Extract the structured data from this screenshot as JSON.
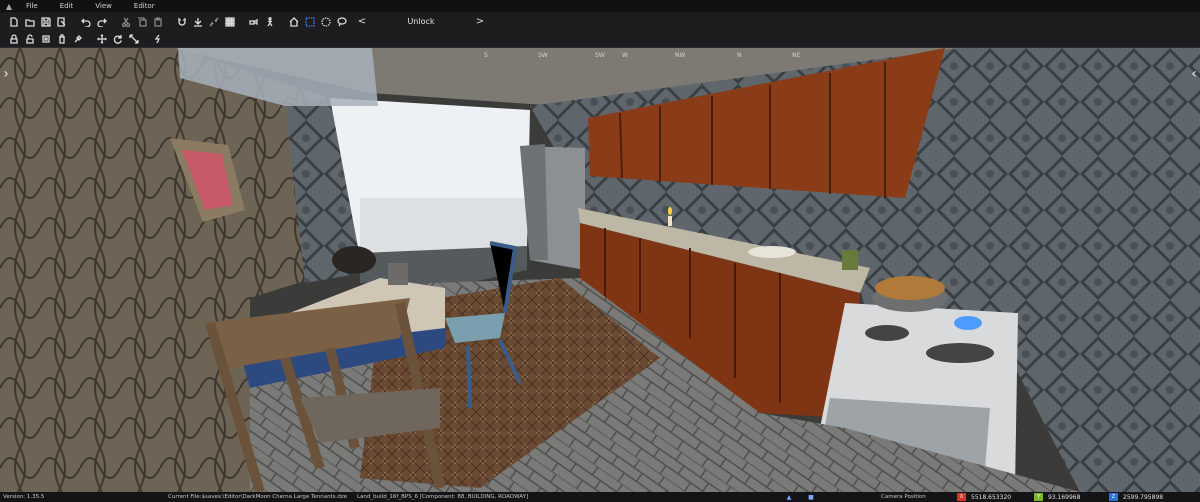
{
  "menubar": {
    "items": [
      "File",
      "Edit",
      "View",
      "Editor"
    ]
  },
  "toolbar": {
    "unlock_label": "Unlock",
    "prev_arrow": "<",
    "next_arrow": ">",
    "row1_icons": [
      "new-file-icon",
      "open-file-icon",
      "save-icon",
      "save-as-icon",
      "undo-icon",
      "redo-icon",
      "cut-icon",
      "copy-icon",
      "paste-icon",
      "magnet-icon",
      "snap-ground-icon",
      "collapse-icon",
      "grid-icon",
      "camera-speed-icon",
      "walk-icon",
      "home-icon",
      "box-select-icon",
      "circle-select-icon",
      "lasso-select-icon"
    ],
    "row2_icons": [
      "lock-icon",
      "unlock-icon",
      "hide-icon",
      "delete-icon",
      "eyedropper-icon",
      "move-icon",
      "rotate-icon",
      "scale-icon",
      "lightning-icon"
    ]
  },
  "viewport": {
    "compass": [
      "S",
      "SW",
      "SW",
      "W",
      "NW",
      "N",
      "NE"
    ],
    "nav_left": "›",
    "nav_right": "‹"
  },
  "statusbar": {
    "version": "Version:  1.35.5",
    "current_file": "Current File:$saves:\\Editor\\DarkMoon Cherna Large Tennants.dze",
    "object_info": "Land_build_16f_BPS_6 [Component: 88, BUILDING, ROADWAY]",
    "camera_label": "Camera Position",
    "x_tag": "X",
    "x_value": "5518.653320",
    "y_tag": "Y",
    "y_value": "93.169968",
    "z_tag": "Z",
    "z_value": "2599.795898"
  },
  "colors": {
    "x_axis": "#d9302c",
    "y_axis": "#7bb52a",
    "z_axis": "#2f6fd8",
    "active_tool": "#3b82f6"
  }
}
